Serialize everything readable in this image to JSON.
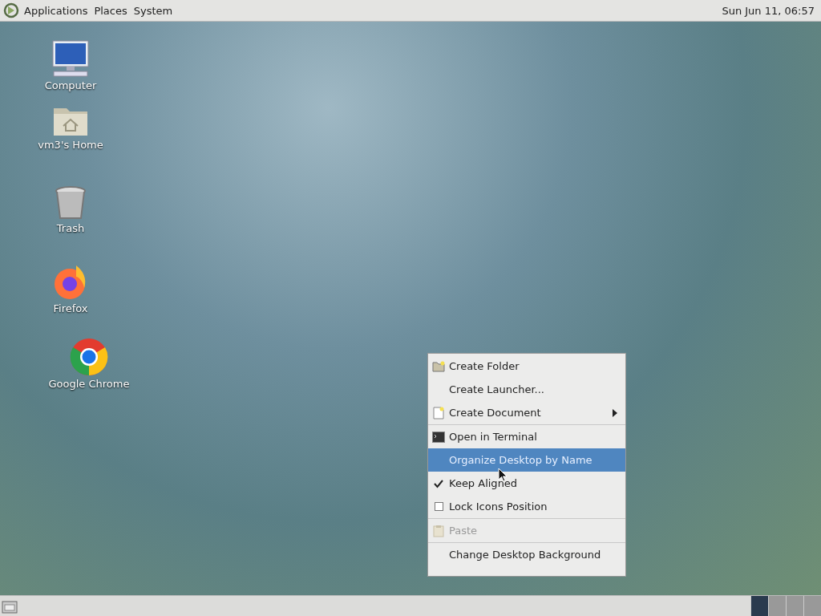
{
  "top_panel": {
    "menus": [
      "Applications",
      "Places",
      "System"
    ],
    "clock": "Sun Jun 11, 06:57"
  },
  "desktop_icons": [
    {
      "label": "Computer",
      "kind": "computer"
    },
    {
      "label": "vm3's Home",
      "kind": "home"
    },
    {
      "label": "Trash",
      "kind": "trash"
    },
    {
      "label": "Firefox",
      "kind": "firefox"
    },
    {
      "label": "Google Chrome",
      "kind": "chrome"
    }
  ],
  "context_menu": {
    "groups": [
      [
        {
          "label": "Create Folder",
          "kind": "folder",
          "selected": false,
          "disabled": false
        },
        {
          "label": "Create Launcher...",
          "kind": "plain",
          "selected": false,
          "disabled": false
        },
        {
          "label": "Create Document",
          "kind": "document",
          "selected": false,
          "disabled": false,
          "submenu": true
        }
      ],
      [
        {
          "label": "Open in Terminal",
          "kind": "terminal",
          "selected": false,
          "disabled": false
        },
        {
          "label": "Organize Desktop by Name",
          "kind": "plain",
          "selected": true,
          "disabled": false
        },
        {
          "label": "Keep Aligned",
          "kind": "check",
          "checked": true,
          "selected": false,
          "disabled": false
        },
        {
          "label": "Lock Icons Position",
          "kind": "check",
          "checked": false,
          "selected": false,
          "disabled": false
        }
      ],
      [
        {
          "label": "Paste",
          "kind": "paste",
          "selected": false,
          "disabled": true
        }
      ],
      [
        {
          "label": "Change Desktop Background",
          "kind": "plain",
          "selected": false,
          "disabled": false
        }
      ]
    ]
  },
  "bottom_panel": {
    "workspaces": [
      {
        "selected": true
      },
      {
        "selected": false
      },
      {
        "selected": false
      },
      {
        "selected": false
      }
    ]
  }
}
